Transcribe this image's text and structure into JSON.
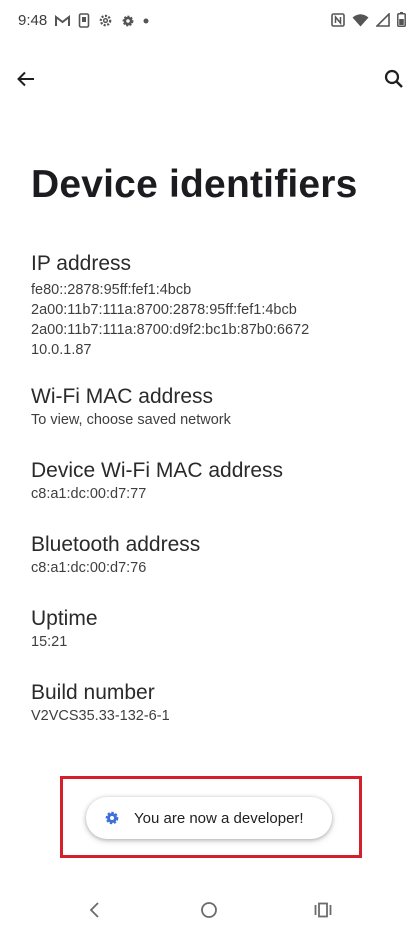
{
  "status_bar": {
    "time": "9:48",
    "left_icons": [
      "gmail-icon",
      "phone-portrait-icon",
      "settings-gear-icon",
      "gear-icon",
      "dot-icon"
    ],
    "right_icons": [
      "nfc-icon",
      "wifi-icon",
      "cellular-signal-icon",
      "battery-icon"
    ]
  },
  "top_bar": {
    "back_icon": "arrow-left-icon",
    "search_icon": "search-icon"
  },
  "page": {
    "title": "Device identifiers"
  },
  "items": {
    "ip": {
      "title": "IP address",
      "lines": [
        "fe80::2878:95ff:fef1:4bcb",
        "2a00:11b7:111a:8700:2878:95ff:fef1:4bcb",
        "2a00:11b7:111a:8700:d9f2:bc1b:87b0:6672",
        "10.0.1.87"
      ]
    },
    "wifi_mac": {
      "title": "Wi-Fi MAC address",
      "value": "To view, choose saved network"
    },
    "device_wifi_mac": {
      "title": "Device Wi-Fi MAC address",
      "value": "c8:a1:dc:00:d7:77"
    },
    "bluetooth": {
      "title": "Bluetooth address",
      "value": "c8:a1:dc:00:d7:76"
    },
    "uptime": {
      "title": "Uptime",
      "value": "15:21"
    },
    "build": {
      "title": "Build number",
      "value": "V2VCS35.33-132-6-1"
    }
  },
  "toast": {
    "text": "You are now a developer!",
    "icon": "settings-gear-icon"
  },
  "colors": {
    "highlight_frame": "#d4202a",
    "toast_icon": "#3f6fd8"
  },
  "nav_bar": {
    "back_icon": "nav-back-chevron-icon",
    "home_icon": "nav-home-circle-icon",
    "recents_icon": "nav-recents-icon"
  }
}
